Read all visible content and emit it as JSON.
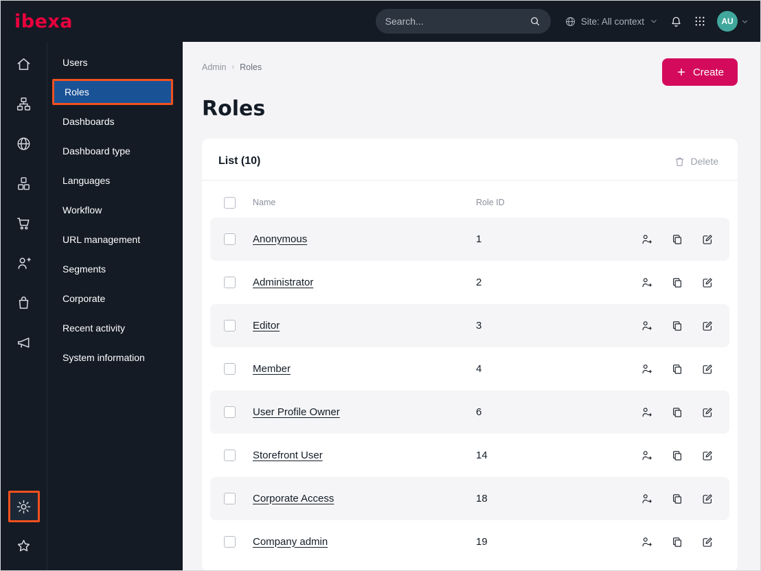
{
  "topbar": {
    "logo_text": "ibexa",
    "search_placeholder": "Search...",
    "site_context_label": "Site: All context",
    "avatar_initials": "AU"
  },
  "icon_rail": {
    "items": [
      "home",
      "content-tree",
      "site",
      "product-catalog",
      "commerce",
      "customers",
      "orders",
      "marketing"
    ],
    "bottom_items": [
      "settings",
      "bookmarks"
    ],
    "active": "settings"
  },
  "menu": {
    "items": [
      "Users",
      "Roles",
      "Dashboards",
      "Dashboard type",
      "Languages",
      "Workflow",
      "URL management",
      "Segments",
      "Corporate",
      "Recent activity",
      "System information"
    ],
    "active_item": "Roles"
  },
  "breadcrumb": {
    "root": "Admin",
    "current": "Roles"
  },
  "page": {
    "title": "Roles",
    "create_button": "Create"
  },
  "list": {
    "header": "List (10)",
    "delete_button": "Delete",
    "columns": {
      "name": "Name",
      "role_id": "Role ID"
    },
    "rows": [
      {
        "name": "Anonymous",
        "role_id": "1"
      },
      {
        "name": "Administrator",
        "role_id": "2"
      },
      {
        "name": "Editor",
        "role_id": "3"
      },
      {
        "name": "Member",
        "role_id": "4"
      },
      {
        "name": "User Profile Owner",
        "role_id": "6"
      },
      {
        "name": "Storefront User",
        "role_id": "14"
      },
      {
        "name": "Corporate Access",
        "role_id": "18"
      },
      {
        "name": "Company admin",
        "role_id": "19"
      }
    ]
  },
  "colors": {
    "brand_red": "#e8003d",
    "create_button_bg": "#d40b5c",
    "highlight_border": "#f4511e",
    "active_menu_bg": "#1a5296",
    "avatar_bg": "#41a79c",
    "topbar_bg": "#141b25"
  }
}
